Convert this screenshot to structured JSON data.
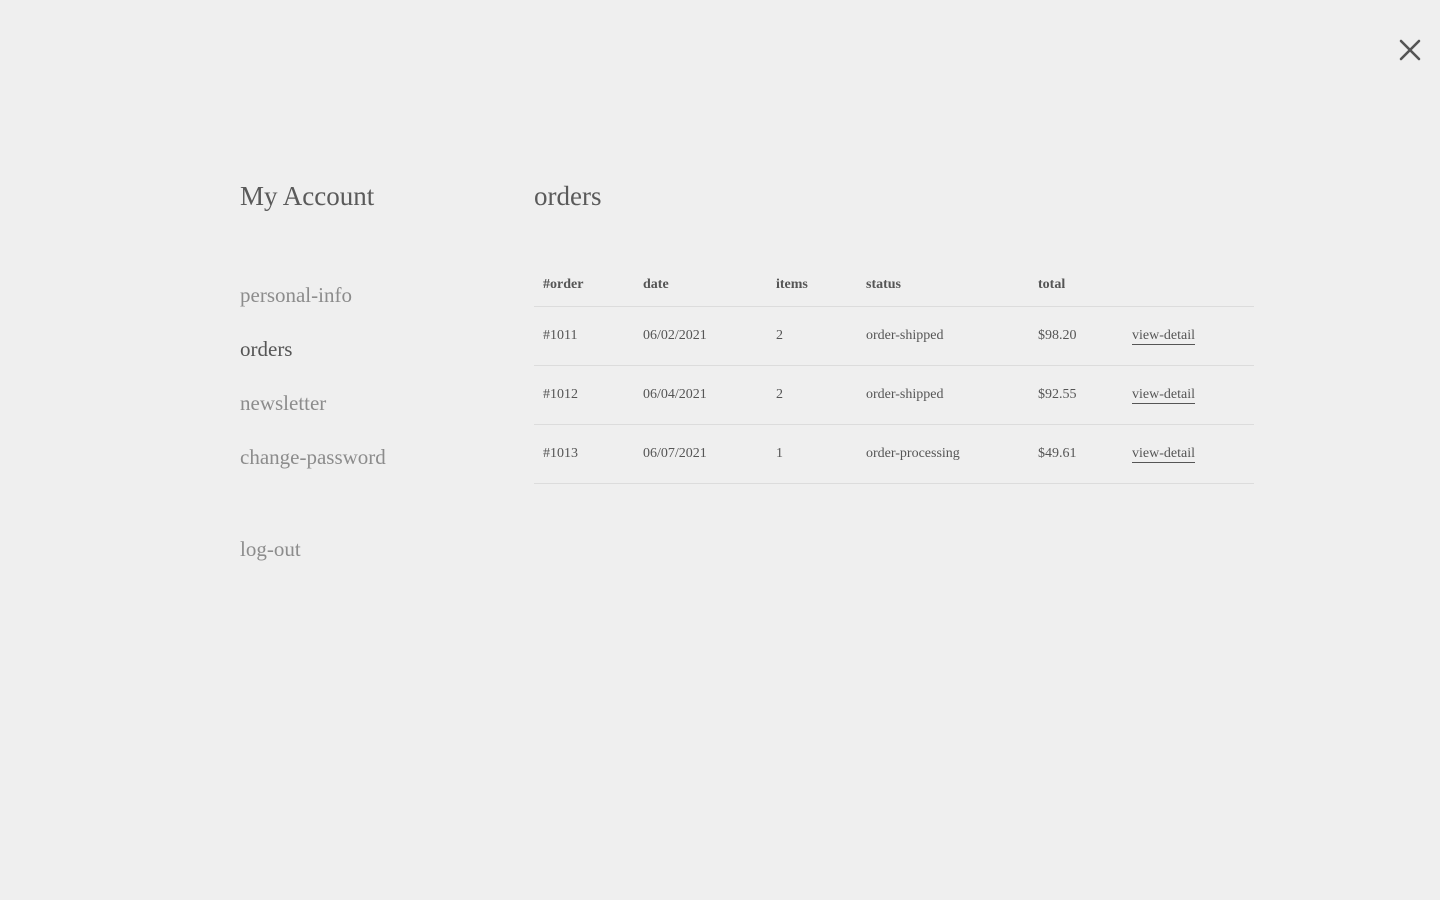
{
  "close": {
    "icon": "close-icon"
  },
  "sidebar": {
    "title": "My Account",
    "items": [
      {
        "label": "personal-info",
        "active": false
      },
      {
        "label": "orders",
        "active": true
      },
      {
        "label": "newsletter",
        "active": false
      },
      {
        "label": "change-password",
        "active": false
      }
    ],
    "logout": "log-out"
  },
  "main": {
    "title": "orders",
    "columns": [
      "#order",
      "date",
      "items",
      "status",
      "total",
      ""
    ],
    "rows": [
      {
        "order": "#1011",
        "date": "06/02/2021",
        "items": "2",
        "status": "order-shipped",
        "total": "$98.20",
        "link": "view-detail"
      },
      {
        "order": "#1012",
        "date": "06/04/2021",
        "items": "2",
        "status": "order-shipped",
        "total": "$92.55",
        "link": "view-detail"
      },
      {
        "order": "#1013",
        "date": "06/07/2021",
        "items": "1",
        "status": "order-processing",
        "total": "$49.61",
        "link": "view-detail"
      }
    ]
  },
  "colors": {
    "background": "#efefef",
    "text": "#555555",
    "muted": "#8c8c8c",
    "divider": "#dcdcdc"
  }
}
